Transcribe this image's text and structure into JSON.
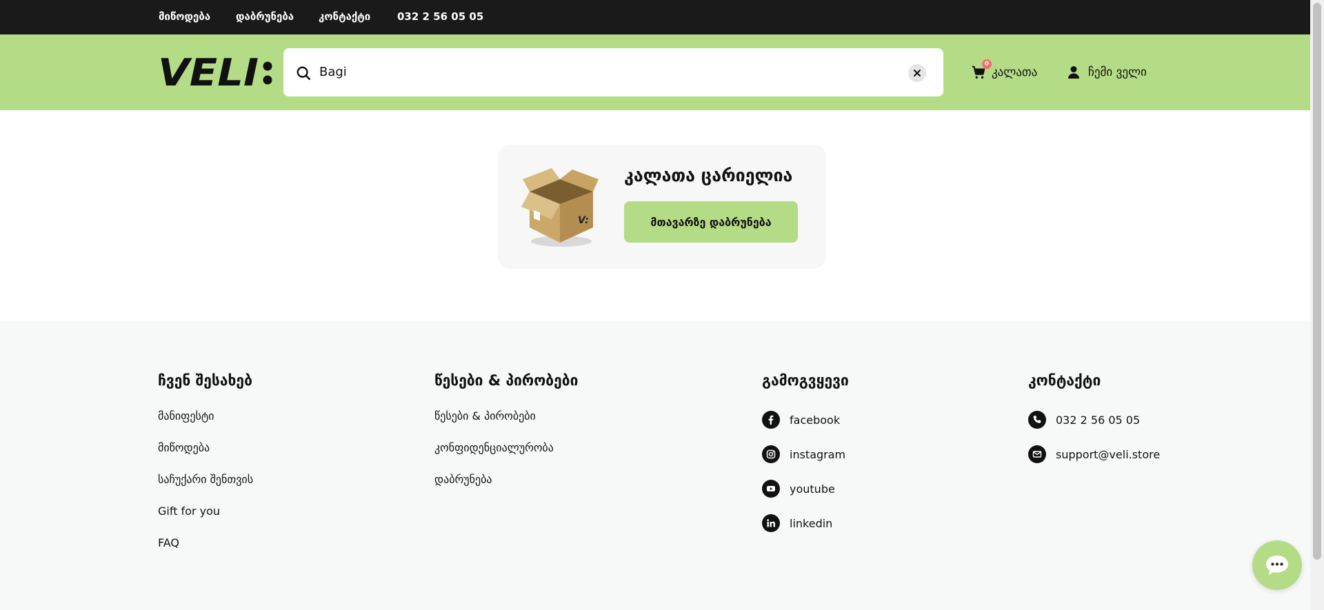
{
  "topbar": {
    "links": [
      "მიწოდება",
      "დაბრუნება",
      "კონტაქტი",
      "032 2 56 05 05"
    ]
  },
  "header": {
    "logo_text": "VELI:",
    "search": {
      "value": "Bagi",
      "icon": "search-icon"
    },
    "cart": {
      "count": "0",
      "label": "კალათა",
      "icon": "cart-icon"
    },
    "account": {
      "label": "ჩემი ველი",
      "icon": "user-icon"
    }
  },
  "main": {
    "empty_title": "კალათა ცარიელია",
    "home_button": "მთავარზე დაბრუნება"
  },
  "footer": {
    "about": {
      "title": "ჩვენ შესახებ",
      "items": [
        "მანიფესტი",
        "მიწოდება",
        "საჩუქარი შენთვის",
        "Gift for you",
        "FAQ"
      ]
    },
    "terms": {
      "title": "წესები & პირობები",
      "items": [
        "წესები & პირობები",
        "კონფიდენციალურობა",
        "დაბრუნება"
      ]
    },
    "follow": {
      "title": "გამოგვყევი",
      "items": [
        "facebook",
        "instagram",
        "youtube",
        "linkedin"
      ]
    },
    "contact": {
      "title": "კონტაქტი",
      "items": [
        "032 2 56 05 05",
        "support@veli.store"
      ]
    }
  },
  "colors": {
    "topbar_bg": "#1a1a1a",
    "accent_green": "#b4dc86",
    "badge_red": "#f06e6e",
    "footer_bg": "#f7f8f8"
  }
}
